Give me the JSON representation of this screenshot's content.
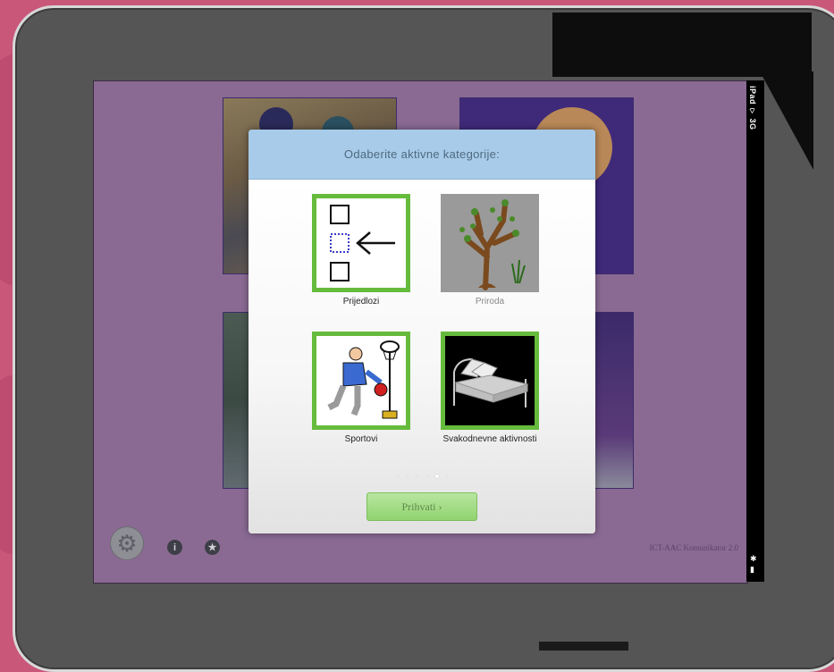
{
  "status_bar": {
    "carrier": "iPad",
    "network": "3G"
  },
  "modal": {
    "title": "Odaberite aktivne kategorije:",
    "categories": [
      {
        "label": "Prijedlozi",
        "selected": true,
        "icon": "prepositions-icon"
      },
      {
        "label": "Priroda",
        "selected": false,
        "icon": "tree-icon"
      },
      {
        "label": "Sportovi",
        "selected": true,
        "icon": "basketball-player-icon"
      },
      {
        "label": "Svakodnevne aktivnosti",
        "selected": true,
        "icon": "bed-icon"
      }
    ],
    "pager": {
      "pages": 6,
      "active_index": 4
    },
    "accept_label": "Prihvati ›"
  },
  "footer": {
    "app_version": "ICT-AAC Komunikator 2.0"
  },
  "colors": {
    "selected_border": "#66bb3c",
    "header_bg": "#a7cbe8",
    "screen_bg": "#8a6a93",
    "accept_bg": "#92d36f"
  }
}
